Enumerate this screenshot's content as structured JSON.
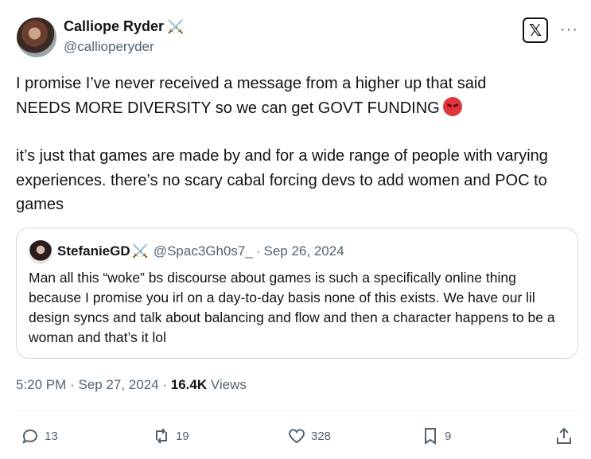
{
  "author": {
    "name": "Calliope Ryder",
    "badge": "⚔️",
    "handle": "@callioperyder"
  },
  "post": {
    "line1": "I promise I’ve never received a message from a higher up that said",
    "line2": "NEEDS MORE DIVERSITY so we can get GOVT FUNDING",
    "emoji": "angry-face-icon",
    "para2": "it’s just that games are made by and for a wide range of people with varying experiences. there’s no scary cabal forcing devs to add women and POC to games"
  },
  "quote": {
    "name": "StefanieGD",
    "badge": "⚔️",
    "handle": "@Spac3Gh0s7_",
    "sep": "·",
    "date": "Sep 26, 2024",
    "text": "Man all this “woke” bs discourse about games is such a specifically online thing because I promise you irl on a day-to-day basis none of this exists. We have our lil design syncs and talk about balancing and flow and then a character happens to be a woman and that’s it lol"
  },
  "meta": {
    "time": "5:20 PM",
    "sep": "·",
    "date": "Sep 27, 2024",
    "views_count": "16.4K",
    "views_label": "Views"
  },
  "actions": {
    "replies": "13",
    "reposts": "19",
    "likes": "328",
    "bookmarks": "9"
  },
  "header": {
    "logo": "𝕏",
    "more": "···"
  }
}
